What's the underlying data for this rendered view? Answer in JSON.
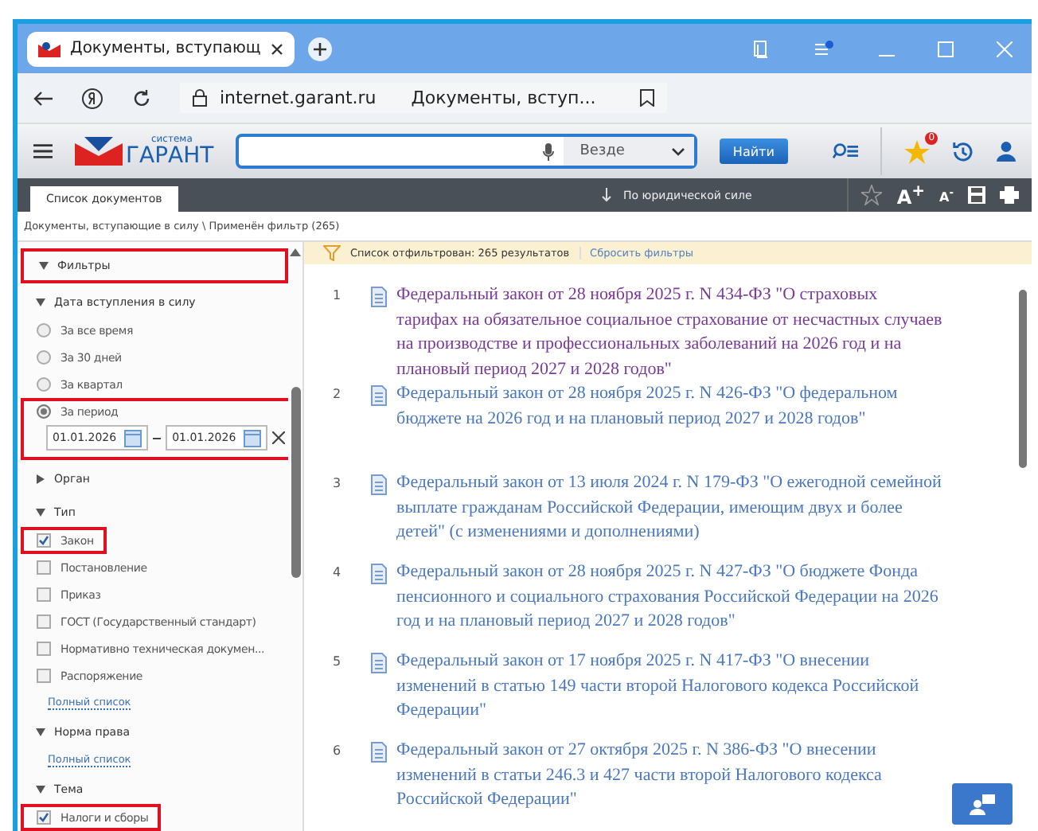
{
  "browser": {
    "tab_title": "Документы, вступающ",
    "url": "internet.garant.ru",
    "page_title": "Документы, вступ..."
  },
  "header": {
    "logo_small": "система",
    "logo": "ГАРАНТ",
    "scope": "Везде",
    "search_button": "Найти",
    "favorites_badge": "0"
  },
  "toolbar": {
    "tab": "Список документов",
    "sort": "По юридической силе",
    "font_up": "A$^{+}$",
    "font_down": "A$^{-}$"
  },
  "breadcrumb": "Документы, вступающие в силу \\ Применён фильтр (265)",
  "filters": {
    "title": "Фильтры",
    "expanded": true,
    "highlighted": true,
    "groups": [
      {
        "title": "Дата вступления в силу",
        "expanded": true,
        "items": [
          {
            "kind": "radio",
            "label": "За все время",
            "selected": false,
            "highlighted": false
          },
          {
            "kind": "radio",
            "label": "За 30 дней",
            "selected": false,
            "highlighted": false
          },
          {
            "kind": "radio",
            "label": "За квартал",
            "selected": false,
            "highlighted": false
          },
          {
            "kind": "radio",
            "label": "За период",
            "selected": true,
            "highlighted": true,
            "from": "01.01.2026",
            "to": "01.01.2026"
          }
        ]
      },
      {
        "title": "Орган",
        "expanded": false
      },
      {
        "title": "Тип",
        "expanded": true,
        "items": [
          {
            "kind": "checkbox",
            "label": "Закон",
            "checked": true,
            "highlighted": true
          },
          {
            "kind": "checkbox",
            "label": "Постановление",
            "checked": false,
            "highlighted": false
          },
          {
            "kind": "checkbox",
            "label": "Приказ",
            "checked": false,
            "highlighted": false
          },
          {
            "kind": "checkbox",
            "label": "ГОСТ (Государственный стандарт)",
            "checked": false,
            "highlighted": false
          },
          {
            "kind": "checkbox",
            "label": "Нормативно техническая докумен...",
            "checked": false,
            "highlighted": false
          },
          {
            "kind": "checkbox",
            "label": "Распоряжение",
            "checked": false,
            "highlighted": false
          },
          {
            "kind": "link",
            "label": "Полный список"
          }
        ]
      },
      {
        "title": "Норма права",
        "expanded": true,
        "items": [
          {
            "kind": "link",
            "label": "Полный список"
          }
        ]
      },
      {
        "title": "Тема",
        "expanded": true,
        "items": [
          {
            "kind": "checkbox",
            "label": "Налоги и сборы",
            "checked": true,
            "highlighted": true
          }
        ]
      }
    ]
  },
  "results": {
    "summary": "Список отфильтрован: 265 результатов",
    "reset": "Сбросить фильтры",
    "items": [
      {
        "number": "1",
        "title": "Федеральный закон от 28 ноября 2025 г. N 434-ФЗ \"О страховых тарифах на обязательное социальное страхование от несчастных случаев на производстве и профессиональных заболеваний на 2026 год и на плановый период 2027 и 2028 годов\"",
        "visited": true
      },
      {
        "number": "2",
        "title": "Федеральный закон от 28 ноября 2025 г. N 426-ФЗ \"О федеральном бюджете на 2026 год и на плановый период 2027 и 2028 годов\"",
        "visited": false
      },
      {
        "number": "3",
        "title": "Федеральный закон от 13 июля 2024 г. N 179-ФЗ \"О ежегодной семейной выплате гражданам Российской Федерации, имеющим двух и более детей\" (с изменениями и дополнениями)",
        "visited": false
      },
      {
        "number": "4",
        "title": "Федеральный закон от 28 ноября 2025 г. N 427-ФЗ \"О бюджете Фонда пенсионного и социального страхования Российской Федерации на 2026 год и на плановый период 2027 и 2028 годов\"",
        "visited": false
      },
      {
        "number": "5",
        "title": "Федеральный закон от 17 ноября 2025 г. N 417-ФЗ \"О внесении изменений в статью 149 части второй Налогового кодекса Российской Федерации\"",
        "visited": false
      },
      {
        "number": "6",
        "title": "Федеральный закон от 27 октября 2025 г. N 386-ФЗ \"О внесении изменений в статьи 246.3 и 427 части второй Налогового кодекса Российской Федерации\"",
        "visited": false
      }
    ]
  }
}
